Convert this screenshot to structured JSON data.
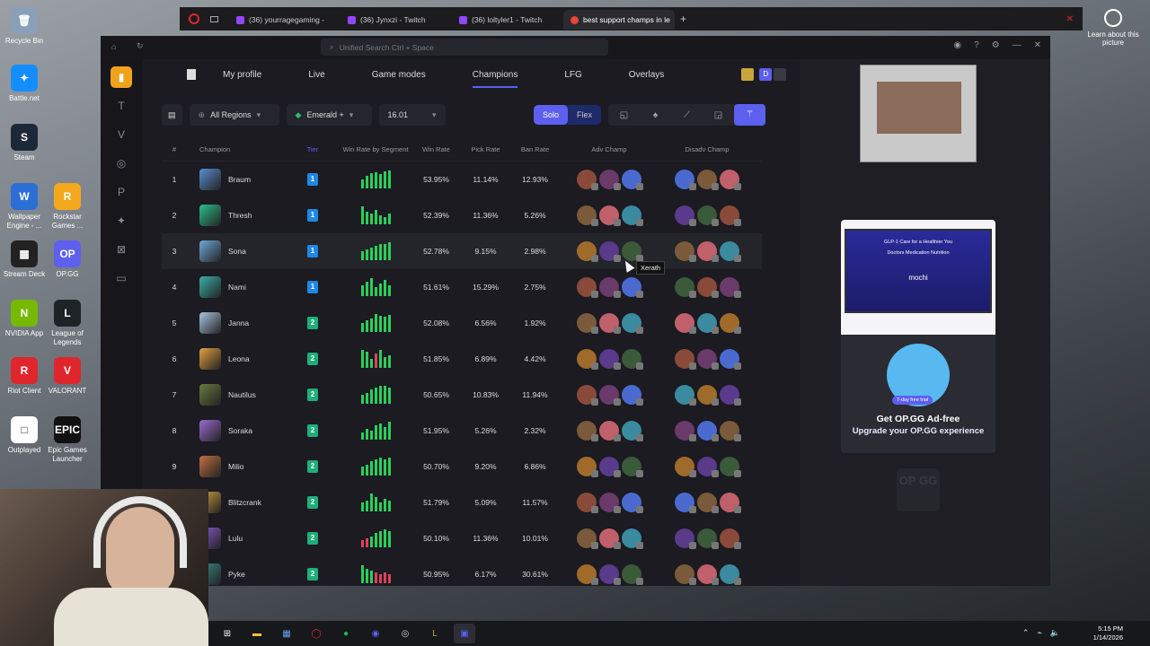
{
  "desktop": {
    "icons": [
      {
        "label": "Recycle Bin",
        "glyph": "🗑",
        "color": "#8aa0b8"
      },
      {
        "label": "Battle.net",
        "glyph": "✦",
        "color": "#148eff"
      },
      {
        "label": "Steam",
        "glyph": "S",
        "color": "#1b2838"
      },
      {
        "label": "Wallpaper Engine - ...",
        "glyph": "W",
        "color": "#2b6fd6"
      },
      {
        "label": "Rockstar Games ...",
        "glyph": "R",
        "color": "#f3a81d"
      },
      {
        "label": "Stream Deck",
        "glyph": "▦",
        "color": "#222"
      },
      {
        "label": "OP.GG",
        "glyph": "OP",
        "color": "#5d5fef"
      },
      {
        "label": "NVIDIA App",
        "glyph": "N",
        "color": "#76b900"
      },
      {
        "label": "League of Legends",
        "glyph": "L",
        "color": "#1e2328"
      },
      {
        "label": "Riot Client",
        "glyph": "R",
        "color": "#e0262d"
      },
      {
        "label": "VALORANT",
        "glyph": "V",
        "color": "#e0262d"
      },
      {
        "label": "Outplayed",
        "glyph": "□",
        "color": "#fff"
      },
      {
        "label": "Epic Games Launcher",
        "glyph": "EPIC",
        "color": "#111"
      }
    ],
    "notice": "Learn about this picture"
  },
  "browser": {
    "tabs": [
      {
        "label": "(36) yourragegaming -",
        "kind": "twitch"
      },
      {
        "label": "(36) Jynxzi - Twitch",
        "kind": "twitch"
      },
      {
        "label": "(36) loltyler1 - Twitch",
        "kind": "twitch"
      },
      {
        "label": "best support champs in le",
        "kind": "google",
        "active": true
      }
    ],
    "new_tab": "+"
  },
  "app": {
    "search_placeholder": "Unified Search  Ctrl + Space",
    "nav": [
      {
        "label": "My profile"
      },
      {
        "label": "Live"
      },
      {
        "label": "Game modes"
      },
      {
        "label": "Champions",
        "active": true
      },
      {
        "label": "LFG"
      },
      {
        "label": "Overlays"
      }
    ],
    "avatar_initial": "D",
    "filters": {
      "region": "All Regions",
      "rank": "Emerald +",
      "patch": "16.01",
      "queue_solo": "Solo",
      "queue_flex": "Flex"
    },
    "headers": {
      "rank": "#",
      "champion": "Champion",
      "tier": "Tier",
      "segment": "Win Rate by Segment",
      "win_rate": "Win Rate",
      "pick_rate": "Pick Rate",
      "ban_rate": "Ban Rate",
      "adv": "Adv Champ",
      "disadv": "Disadv Champ"
    },
    "rows": [
      {
        "rank": "1",
        "name": "Braum",
        "tier": "1",
        "wr": "53.95%",
        "pr": "11.14%",
        "br": "12.93%",
        "color": "#5a8fd0",
        "seg": [
          10,
          14,
          17,
          18,
          16,
          19,
          20
        ]
      },
      {
        "rank": "2",
        "name": "Thresh",
        "tier": "1",
        "wr": "52.39%",
        "pr": "11.36%",
        "br": "5.26%",
        "color": "#2bbf8a",
        "seg": [
          20,
          14,
          12,
          16,
          10,
          8,
          12
        ]
      },
      {
        "rank": "3",
        "name": "Sona",
        "tier": "1",
        "wr": "52.78%",
        "pr": "9.15%",
        "br": "2.98%",
        "color": "#6fa8dc",
        "seg": [
          10,
          12,
          14,
          16,
          18,
          18,
          20
        ]
      },
      {
        "rank": "4",
        "name": "Nami",
        "tier": "1",
        "wr": "51.61%",
        "pr": "15.29%",
        "br": "2.75%",
        "color": "#3ab0a6",
        "seg": [
          12,
          16,
          20,
          10,
          14,
          18,
          12
        ]
      },
      {
        "rank": "5",
        "name": "Janna",
        "tier": "2",
        "wr": "52.08%",
        "pr": "6.56%",
        "br": "1.92%",
        "color": "#a8c4e0",
        "seg": [
          10,
          13,
          15,
          20,
          18,
          17,
          19
        ]
      },
      {
        "rank": "6",
        "name": "Leona",
        "tier": "2",
        "wr": "51.85%",
        "pr": "6.89%",
        "br": "4.42%",
        "color": "#e0a040",
        "seg": [
          20,
          18,
          10,
          16,
          20,
          12,
          14
        ]
      },
      {
        "rank": "7",
        "name": "Nautilus",
        "tier": "2",
        "wr": "50.65%",
        "pr": "10.83%",
        "br": "11.94%",
        "color": "#6a7a40",
        "seg": [
          10,
          12,
          16,
          18,
          20,
          20,
          18
        ]
      },
      {
        "rank": "8",
        "name": "Soraka",
        "tier": "2",
        "wr": "51.95%",
        "pr": "5.26%",
        "br": "2.32%",
        "color": "#9a6ad0",
        "seg": [
          8,
          12,
          10,
          16,
          18,
          14,
          20
        ]
      },
      {
        "rank": "9",
        "name": "Milio",
        "tier": "2",
        "wr": "50.70%",
        "pr": "9.20%",
        "br": "6.86%",
        "color": "#c07040",
        "seg": [
          10,
          12,
          16,
          18,
          20,
          18,
          20
        ]
      },
      {
        "rank": "10",
        "name": "Blitzcrank",
        "tier": "2",
        "wr": "51.79%",
        "pr": "5.09%",
        "br": "11.57%",
        "color": "#d0a040",
        "seg": [
          10,
          12,
          20,
          16,
          10,
          14,
          12
        ]
      },
      {
        "rank": "11",
        "name": "Lulu",
        "tier": "2",
        "wr": "50.10%",
        "pr": "11.36%",
        "br": "10.01%",
        "color": "#8a5ad0",
        "seg": [
          8,
          10,
          12,
          16,
          18,
          20,
          18
        ]
      },
      {
        "rank": "12",
        "name": "Pyke",
        "tier": "2",
        "wr": "50.95%",
        "pr": "6.17%",
        "br": "30.61%",
        "color": "#3a8a8a",
        "seg": [
          20,
          16,
          14,
          12,
          10,
          12,
          10
        ]
      }
    ],
    "tooltip": "Xerath"
  },
  "ad": {
    "banner_title": "GLP-1 Care for a Healthier You",
    "banner_items": "Doctors     Medication     Nutrition",
    "banner_logo": "mochi",
    "trial": "7-day free trial",
    "title": "Get OP.GG Ad-free",
    "subtitle": "Upgrade your OP.GG experience",
    "watermark": "OP GG"
  },
  "taskbar": {
    "time": "5:15 PM",
    "date": "1/14/2026"
  }
}
